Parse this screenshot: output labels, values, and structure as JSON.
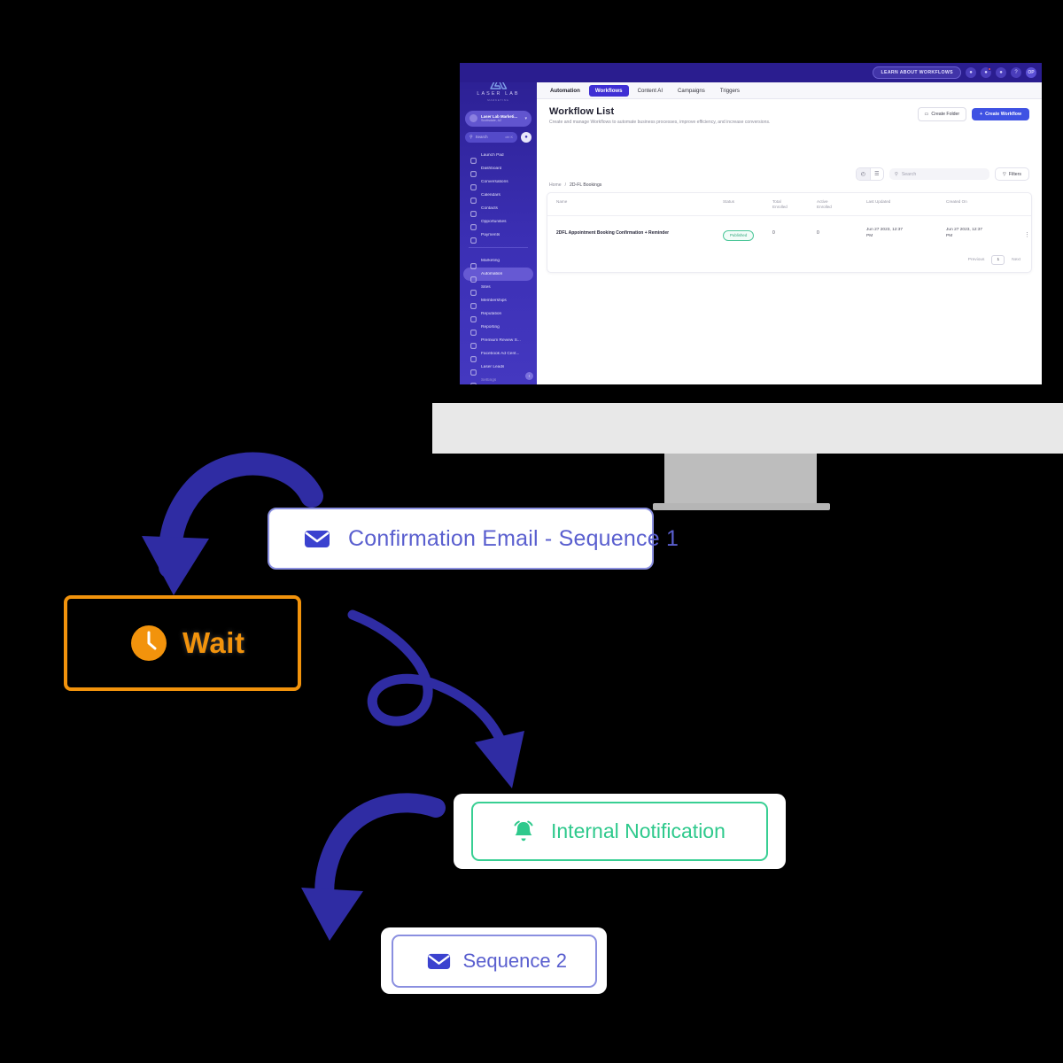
{
  "app": {
    "topbar": {
      "learn_pill": "LEARN ABOUT WORKFLOWS",
      "icons": [
        {
          "name": "user-circle-icon",
          "glyph": "●"
        },
        {
          "name": "notifications-icon",
          "glyph": "●"
        },
        {
          "name": "bell-icon",
          "glyph": "●"
        },
        {
          "name": "help-icon",
          "glyph": "?"
        },
        {
          "name": "avatar-icon",
          "glyph": "OP"
        }
      ]
    },
    "sidebar": {
      "logo_text": "LASER LAB",
      "logo_sub": "MARKETING",
      "workspace_name": "Laser Lab Marketi...",
      "workspace_location": "Scottsdale, AZ",
      "workspace_caret": "▾",
      "search_placeholder": "Search",
      "search_shortcut": "ctrl K",
      "items": [
        {
          "label": "Launch Pad",
          "icon": "rocket-icon"
        },
        {
          "label": "Dashboard",
          "icon": "dashboard-icon"
        },
        {
          "label": "Conversations",
          "icon": "chat-icon"
        },
        {
          "label": "Calendars",
          "icon": "calendar-icon"
        },
        {
          "label": "Contacts",
          "icon": "contacts-icon"
        },
        {
          "label": "Opportunities",
          "icon": "opportunities-icon"
        },
        {
          "label": "Payments",
          "icon": "payments-icon"
        }
      ],
      "items2": [
        {
          "label": "Marketing",
          "icon": "marketing-icon",
          "state": "normal"
        },
        {
          "label": "Automation",
          "icon": "automation-icon",
          "state": "active"
        },
        {
          "label": "Sites",
          "icon": "sites-icon",
          "state": "normal"
        },
        {
          "label": "Memberships",
          "icon": "memberships-icon",
          "state": "normal"
        },
        {
          "label": "Reputation",
          "icon": "reputation-icon",
          "state": "normal"
        },
        {
          "label": "Reporting",
          "icon": "reporting-icon",
          "state": "normal"
        },
        {
          "label": "Premium Review S...",
          "icon": "premium-review-icon",
          "state": "normal"
        },
        {
          "label": "Facebook Ad Cent...",
          "icon": "facebook-ads-icon",
          "state": "normal"
        },
        {
          "label": "Laser Leads",
          "icon": "laser-leads-icon",
          "state": "normal"
        },
        {
          "label": "Settings",
          "icon": "gear-icon",
          "state": "dim"
        }
      ],
      "collapse_glyph": "‹"
    },
    "tabs": [
      {
        "label": "Automation",
        "active": false,
        "strong": true
      },
      {
        "label": "Workflows",
        "active": true,
        "strong": false
      },
      {
        "label": "Content AI",
        "active": false,
        "strong": false
      },
      {
        "label": "Campaigns",
        "active": false,
        "strong": false
      },
      {
        "label": "Triggers",
        "active": false,
        "strong": false
      }
    ],
    "page": {
      "title": "Workflow List",
      "description": "Create and manage Workflows to automate business processes, improve efficiency, and increase conversions.",
      "create_folder_label": "Create Folder",
      "create_workflow_label": "Create Workflow",
      "create_workflow_plus": "+",
      "folder_icon_glyph": "▭"
    },
    "toolbar": {
      "recent_icon": "◴",
      "list_icon": "☰",
      "search_placeholder": "Search",
      "filters_label": "Filters",
      "filters_icon": "▽"
    },
    "breadcrumb": [
      "Home",
      "/",
      "2D-FL Bookings"
    ],
    "table": {
      "columns": [
        "Name",
        "Status",
        "Total Enrolled",
        "Active Enrolled",
        "Last Updated",
        "Created On"
      ],
      "columns_split": [
        {
          "line1": "Name",
          "line2": ""
        },
        {
          "line1": "Status",
          "line2": ""
        },
        {
          "line1": "Total",
          "line2": "Enrolled"
        },
        {
          "line1": "Active",
          "line2": "Enrolled"
        },
        {
          "line1": "Last Updated",
          "line2": ""
        },
        {
          "line1": "Created On",
          "line2": ""
        }
      ],
      "rows": [
        {
          "name": "2DFL Appointment Booking Confirmation + Reminder",
          "status": "Published",
          "total_enrolled": "0",
          "active_enrolled": "0",
          "last_updated_line1": "Jun 27 2023, 12:37",
          "last_updated_line2": "PM",
          "created_on_line1": "Jun 27 2023, 12:37",
          "created_on_line2": "PM",
          "menu_glyph": "⋮"
        }
      ]
    },
    "pagination": {
      "previous_label": "Previous",
      "current_page": "1",
      "next_label": "Next"
    }
  },
  "flow": {
    "nodes": [
      {
        "id": "confirmation",
        "label": "Confirmation Email - Sequence 1",
        "icon": "email-icon",
        "color": "#5a5fcf"
      },
      {
        "id": "wait",
        "label": "Wait",
        "icon": "clock-icon",
        "color": "#f2930c"
      },
      {
        "id": "notification",
        "label": "Internal Notification",
        "icon": "bell-icon",
        "color": "#2ec98c"
      },
      {
        "id": "sequence2",
        "label": "Sequence 2",
        "icon": "email-icon",
        "color": "#5a5fcf"
      }
    ],
    "arrow_color": "#2f2ca3"
  },
  "colors": {
    "brand_purple": "#2a1d8f",
    "accent_blue": "#3f52e3",
    "node_blue": "#5a5fcf",
    "node_orange": "#f2930c",
    "node_green": "#2ec98c",
    "arrow_navy": "#2f2ca3",
    "status_green": "#2fa87c"
  }
}
